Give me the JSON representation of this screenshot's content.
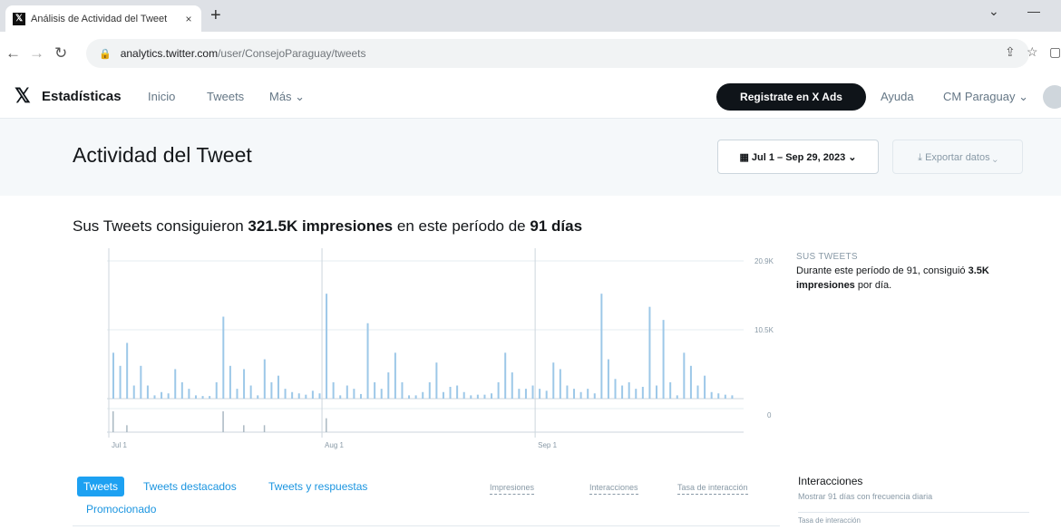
{
  "browser": {
    "tab_title": "Análisis de Actividad del Tweet",
    "tab_close": "×",
    "new_tab": "+",
    "url_host": "analytics.twitter.com",
    "url_path": "/user/ConsejoParaguay/tweets"
  },
  "nav": {
    "brand": "Estadísticas",
    "links": [
      "Inicio",
      "Tweets",
      "Más ⌄"
    ],
    "ads_button": "Registrate en X Ads",
    "help": "Ayuda",
    "account": "CM Paraguay ⌄"
  },
  "header": {
    "title": "Actividad del Tweet",
    "date_range": "Jul 1 – Sep 29, 2023 ⌄",
    "export": "Exportar datos ⌄"
  },
  "summary": {
    "prefix": "Sus Tweets consiguieron",
    "impressions": "321.5K impresiones",
    "middle": "en este período de",
    "days": "91 días"
  },
  "chart_data": {
    "type": "bar",
    "ylabel": "",
    "y_ticks": [
      "20.9K",
      "10.5K"
    ],
    "x_ticks": [
      "Jul 1",
      "Aug 1",
      "Sep 1"
    ],
    "small_scale_tick": "0",
    "x_range": [
      "Jul 1",
      "Sep 29"
    ],
    "ylim": [
      0,
      21000
    ],
    "values": [
      7000,
      5000,
      8500,
      2000,
      5000,
      2000,
      500,
      1000,
      800,
      4500,
      2500,
      1500,
      500,
      400,
      400,
      2500,
      12500,
      5000,
      1500,
      4500,
      2000,
      500,
      6000,
      2500,
      3500,
      1500,
      1000,
      800,
      600,
      1200,
      800,
      16000,
      2500,
      500,
      2000,
      1500,
      700,
      11500,
      2500,
      1500,
      4000,
      7000,
      2500,
      500,
      500,
      1000,
      2500,
      5500,
      1000,
      1800,
      2000,
      1000,
      500,
      600,
      600,
      800,
      2500,
      7000,
      4000,
      1500,
      1500,
      2000,
      1500,
      1200,
      5500,
      4500,
      2000,
      1500,
      1000,
      1500,
      800,
      16000,
      6000,
      3000,
      2000,
      2500,
      1500,
      1800,
      14000,
      2000,
      12000,
      2500,
      500,
      7000,
      5000,
      2000,
      3500,
      1000,
      800,
      600,
      500
    ],
    "secondary_values": [
      3,
      0,
      1,
      0,
      0,
      0,
      0,
      0,
      0,
      0,
      0,
      0,
      0,
      0,
      0,
      0,
      3,
      0,
      0,
      1,
      0,
      0,
      1,
      0,
      0,
      0,
      0,
      0,
      0,
      0,
      0,
      2,
      0,
      0,
      0,
      0,
      0,
      0,
      0,
      0,
      0,
      0,
      0,
      0,
      0,
      0,
      0,
      0,
      0,
      0,
      0,
      0,
      0,
      0,
      0,
      0,
      0,
      0,
      0,
      0,
      0,
      0,
      0,
      0,
      0,
      0,
      0,
      0,
      0,
      0,
      0,
      0,
      0,
      0,
      0,
      0,
      0,
      0,
      0,
      0,
      0,
      0,
      0,
      0,
      0,
      0,
      0,
      0,
      0,
      0,
      0
    ],
    "color": "#9dc8e8"
  },
  "side_panel": {
    "heading": "SUS TWEETS",
    "text_a": "Durante este período de 91, consiguió",
    "text_b": "3.5K impresiones",
    "text_c": "por día."
  },
  "tabs": {
    "items": [
      "Tweets",
      "Tweets destacados",
      "Tweets y respuestas"
    ],
    "promo": "Promocionado",
    "metrics": [
      "Impresiones",
      "Interacciones",
      "Tasa de interacción"
    ]
  },
  "interactions": {
    "title": "Interacciones",
    "subtitle": "Mostrar 91 días con frecuencia diaria",
    "cutoff": "Tasa de interacción"
  }
}
